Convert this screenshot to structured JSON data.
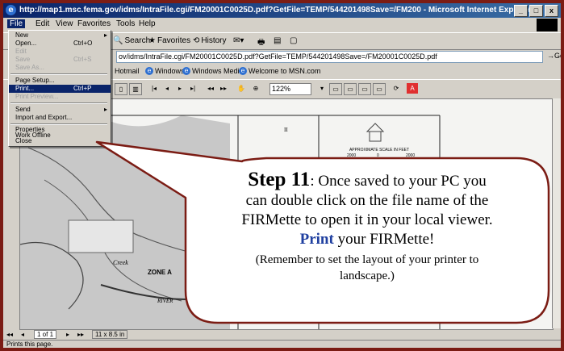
{
  "window": {
    "title": "http://map1.msc.fema.gov/idms/IntraFile.cgi/FM20001C0025D.pdf?GetFile=TEMP/544201498Save=/FM200 - Microsoft Internet Explorer",
    "min": "_",
    "max": "□",
    "close": "x"
  },
  "menu": [
    "File",
    "Edit",
    "View",
    "Favorites",
    "Tools",
    "Help"
  ],
  "toolbar": {
    "search": "Search",
    "favorites": "Favorites",
    "history": "History"
  },
  "address": {
    "url": "ov/idms/IntraFile.cgi/FM20001C0025D.pdf?GetFile=TEMP/544201498Save=/FM20001C0025D.pdf",
    "go": "Go"
  },
  "links": [
    "Hotmail",
    "Windows",
    "Windows Media",
    "Welcome to MSN.com"
  ],
  "pdf": {
    "zoom": "122%"
  },
  "dropdown": [
    {
      "label": "New",
      "shortcut": "",
      "arrow": "▸",
      "state": ""
    },
    {
      "label": "Open...",
      "shortcut": "Ctrl+O",
      "arrow": "",
      "state": ""
    },
    {
      "label": "Edit",
      "shortcut": "",
      "arrow": "",
      "state": "disabled"
    },
    {
      "label": "Save",
      "shortcut": "Ctrl+S",
      "arrow": "",
      "state": "disabled"
    },
    {
      "label": "Save As...",
      "shortcut": "",
      "arrow": "",
      "state": "disabled"
    },
    {
      "label": "Page Setup...",
      "shortcut": "",
      "arrow": "",
      "state": ""
    },
    {
      "label": "Print...",
      "shortcut": "Ctrl+P",
      "arrow": "",
      "state": "hl"
    },
    {
      "label": "Print Preview...",
      "shortcut": "",
      "arrow": "",
      "state": "disabled"
    },
    {
      "label": "Send",
      "shortcut": "",
      "arrow": "▸",
      "state": ""
    },
    {
      "label": "Import and Export...",
      "shortcut": "",
      "arrow": "",
      "state": ""
    },
    {
      "label": "Properties",
      "shortcut": "",
      "arrow": "",
      "state": ""
    },
    {
      "label": "Work Offline",
      "shortcut": "",
      "arrow": "",
      "state": ""
    },
    {
      "label": "Close",
      "shortcut": "",
      "arrow": "",
      "state": ""
    }
  ],
  "map": {
    "zone": "ZONE A",
    "creek": "Creek",
    "river": "RIVER",
    "scale_title": "APPROXIMATE SCALE IN FEET",
    "scale_left": "2000",
    "scale_mid": "0",
    "scale_right": "2000"
  },
  "nav": {
    "page": "1 of 1",
    "size": "11 x 8.5 in"
  },
  "status": "Prints this page.",
  "callout": {
    "step": "Step 11",
    "text1": ": Once saved to your PC you",
    "text2": "can double click on the file name of the",
    "text3": "FIRMette to open it in your local viewer.",
    "print": "Print",
    "text4": " your FIRMette!",
    "note1": "(Remember to set the layout of your printer to",
    "note2": "landscape.)"
  },
  "colors": {
    "outer": "#7b1c14",
    "titlebar": "#0a246a",
    "callout_border": "#7b1c14",
    "print_word": "#1f3fa0"
  }
}
